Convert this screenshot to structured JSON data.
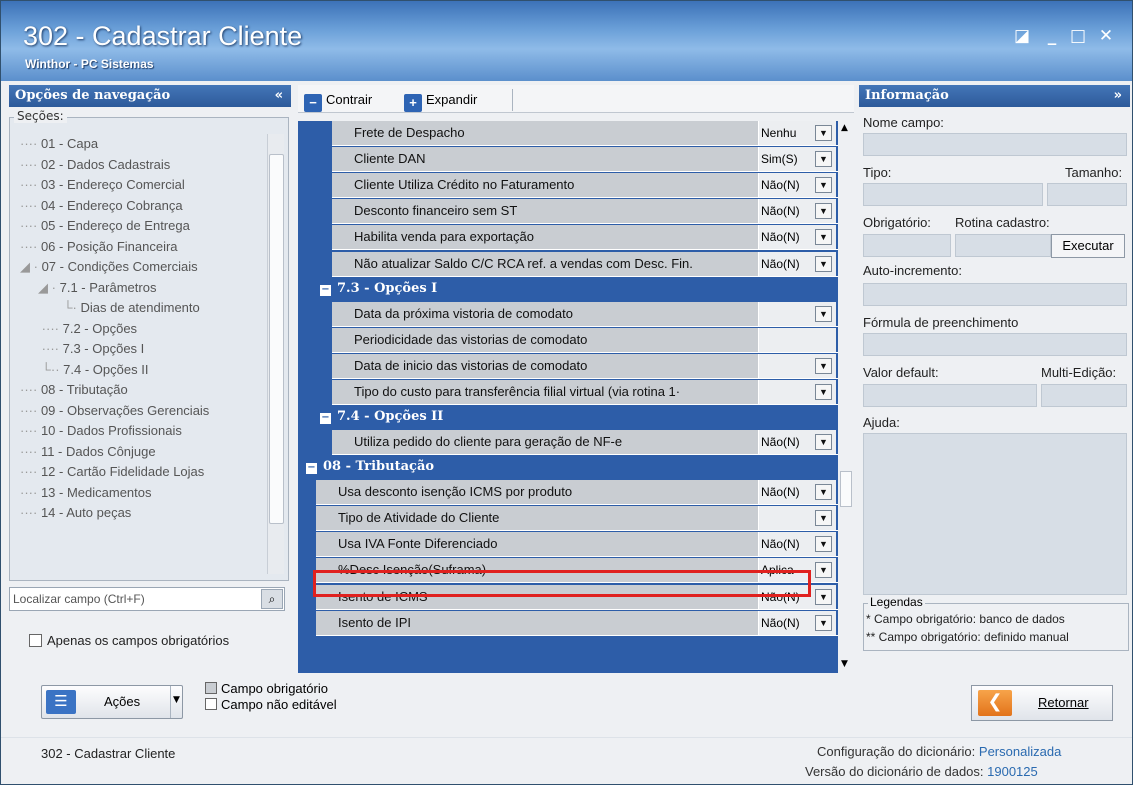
{
  "window": {
    "title": "302 - Cadastrar Cliente",
    "subtitle": "Winthor - PC Sistemas",
    "controls": [
      "◪",
      "_",
      "□",
      "✕"
    ]
  },
  "nav": {
    "header": "Opções de navegação",
    "collapse": "«",
    "sections_label": "Seções:",
    "items": [
      {
        "prefix": "····",
        "label": "01 - Capa"
      },
      {
        "prefix": "····",
        "label": "02 - Dados Cadastrais"
      },
      {
        "prefix": "····",
        "label": "03 - Endereço Comercial"
      },
      {
        "prefix": "····",
        "label": "04 - Endereço Cobrança"
      },
      {
        "prefix": "····",
        "label": "05 - Endereço de Entrega"
      },
      {
        "prefix": "····",
        "label": "06 - Posição Financeira"
      },
      {
        "prefix": "◢ ·",
        "label": "07 - Condições Comerciais"
      },
      {
        "prefix": "     ◢ ·",
        "label": "7.1 - Parâmetros"
      },
      {
        "prefix": "            └·",
        "label": "Dias de atendimento"
      },
      {
        "prefix": "      ····",
        "label": "7.2 - Opções"
      },
      {
        "prefix": "      ····",
        "label": "7.3 - Opções I"
      },
      {
        "prefix": "      └··",
        "label": "7.4 - Opções II"
      },
      {
        "prefix": "····",
        "label": "08 - Tributação"
      },
      {
        "prefix": "····",
        "label": "09 - Observações Gerenciais"
      },
      {
        "prefix": "····",
        "label": "10 - Dados Profissionais"
      },
      {
        "prefix": "····",
        "label": "11 - Dados Cônjuge"
      },
      {
        "prefix": "····",
        "label": "12 - Cartão Fidelidade Lojas"
      },
      {
        "prefix": "····",
        "label": "13 - Medicamentos"
      },
      {
        "prefix": "····",
        "label": "14 - Auto peças"
      }
    ],
    "search_placeholder": "Localizar campo (Ctrl+F)",
    "only_required": "Apenas os campos obrigatórios"
  },
  "toolbar": {
    "collapse_label": "Contrair",
    "expand_label": "Expandir"
  },
  "grid": {
    "rows": [
      {
        "type": "field",
        "indent": 2,
        "label": "Frete de Despacho",
        "value": "Nenhu",
        "dropdown": true
      },
      {
        "type": "field",
        "indent": 2,
        "label": "Cliente DAN",
        "value": "Sim(S)",
        "dropdown": true
      },
      {
        "type": "field",
        "indent": 2,
        "label": "Cliente Utiliza Crédito no Faturamento",
        "value": "Não(N)",
        "dropdown": true
      },
      {
        "type": "field",
        "indent": 2,
        "label": "Desconto financeiro sem ST",
        "value": "Não(N)",
        "dropdown": true
      },
      {
        "type": "field",
        "indent": 2,
        "label": "Habilita venda para exportação",
        "value": "Não(N)",
        "dropdown": true
      },
      {
        "type": "field",
        "indent": 2,
        "label": "Não atualizar Saldo C/C RCA ref. a vendas com Desc. Fin.",
        "value": "Não(N)",
        "dropdown": true
      },
      {
        "type": "section",
        "indent": 1,
        "label": "7.3 - Opções I"
      },
      {
        "type": "field",
        "indent": 2,
        "label": "Data da próxima vistoria de comodato",
        "value": "",
        "dropdown": true
      },
      {
        "type": "field",
        "indent": 2,
        "label": "Periodicidade das vistorias de comodato",
        "value": "",
        "dropdown": false
      },
      {
        "type": "field",
        "indent": 2,
        "label": "Data de inicio das vistorias de comodato",
        "value": "",
        "dropdown": true
      },
      {
        "type": "field",
        "indent": 2,
        "label": "Tipo do custo  para transferência  filial virtual (via rotina 1·",
        "value": "",
        "dropdown": true
      },
      {
        "type": "section",
        "indent": 1,
        "label": "7.4 - Opções II"
      },
      {
        "type": "field",
        "indent": 2,
        "label": "Utiliza pedido do cliente para geração de NF-e",
        "value": "Não(N)",
        "dropdown": true
      },
      {
        "type": "section",
        "indent": 0,
        "label": "08 - Tributação"
      },
      {
        "type": "field",
        "indent": 1,
        "label": "Usa desconto isenção ICMS por produto",
        "value": "Não(N)",
        "dropdown": true
      },
      {
        "type": "field",
        "indent": 1,
        "label": "Tipo de Atividade do Cliente",
        "value": "",
        "dropdown": true
      },
      {
        "type": "field",
        "indent": 1,
        "label": "Usa IVA Fonte Diferenciado",
        "value": "Não(N)",
        "dropdown": true
      },
      {
        "type": "field",
        "indent": 1,
        "label": "%Desc Isenção(Suframa)",
        "value": "Aplica",
        "dropdown": true,
        "highlight": true
      },
      {
        "type": "field",
        "indent": 1,
        "label": "Isento de ICMS",
        "value": "Não(N)",
        "dropdown": true
      },
      {
        "type": "field",
        "indent": 1,
        "label": "Isento de IPI",
        "value": "Não(N)",
        "dropdown": true
      }
    ]
  },
  "info": {
    "header": "Informação",
    "expand": "»",
    "nome_campo": "Nome campo:",
    "tipo": "Tipo:",
    "tamanho": "Tamanho:",
    "obrigatorio": "Obrigatório:",
    "rotina": "Rotina cadastro:",
    "executar": "Executar",
    "auto_inc": "Auto-incremento:",
    "formula": "Fórmula de preenchimento",
    "valor_default": "Valor default:",
    "multi": "Multi-Edição:",
    "ajuda": "Ajuda:",
    "legendas": "Legendas",
    "legend1": "* Campo obrigatório: banco de dados",
    "legend2": "** Campo obrigatório: definido manual"
  },
  "bottom": {
    "acoes": "Ações",
    "legend_required": "Campo obrigatório",
    "legend_noedit": "Campo não editável",
    "retornar": "Retornar"
  },
  "status": {
    "left": "302 - Cadastrar Cliente",
    "config_label": "Configuração do dicionário:",
    "config_value": "Personalizada",
    "version_label": "Versão do dicionário de dados:",
    "version_value": "1900125"
  },
  "colors": {
    "section_blue": "#2d5da8",
    "row_gray": "#c9cdd2",
    "highlight_red": "#e0211f",
    "accent_orange": "#e2731b"
  }
}
